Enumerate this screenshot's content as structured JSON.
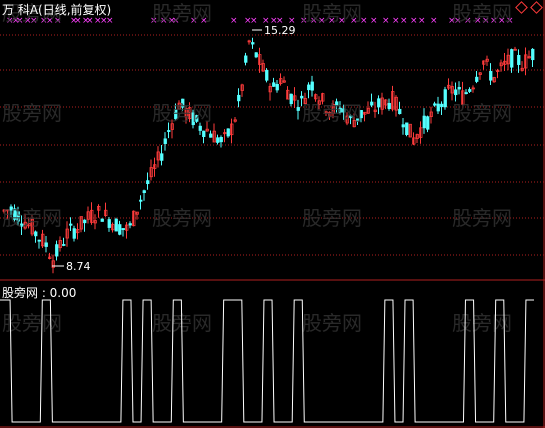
{
  "header": {
    "title": "万 科A(日线,前复权)",
    "indicator_label": "股旁网 : 0.00"
  },
  "watermark": "股旁网",
  "annotations": {
    "high_label": "15.29",
    "low_label": "8.74"
  },
  "colors": {
    "up": "#ff3b3b",
    "down": "#54ffff",
    "grid": "#b02020",
    "marker": "#ff40ff",
    "indicator": "#ffffff"
  },
  "chart_data": {
    "type": "candlestick",
    "title": "万 科A(日线,前复权)",
    "price_high": 15.29,
    "price_low": 8.74,
    "indicator": {
      "name": "股旁网",
      "value": 0.0,
      "type": "step",
      "values": [
        1,
        0,
        0,
        0,
        1,
        0,
        0,
        0,
        0,
        0,
        0,
        0,
        1,
        0,
        1,
        0,
        0,
        1,
        0,
        0,
        0,
        0,
        1,
        1,
        0,
        0,
        1,
        0,
        0,
        1,
        0,
        0,
        0,
        0,
        0,
        0,
        0,
        0,
        1,
        0,
        1,
        0,
        0,
        0,
        0,
        0,
        1,
        0,
        0,
        1,
        0,
        0,
        1
      ]
    }
  }
}
